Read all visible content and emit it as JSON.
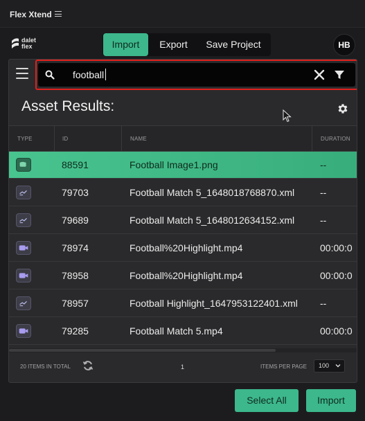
{
  "app": {
    "title": "Flex Xtend"
  },
  "logo": {
    "line1": "dalet",
    "line2": "flex"
  },
  "nav": {
    "tabs": [
      {
        "label": "Import",
        "active": true
      },
      {
        "label": "Export",
        "active": false
      },
      {
        "label": "Save Project",
        "active": false
      }
    ],
    "avatar": "HB"
  },
  "search": {
    "value": "football",
    "icons": [
      "search-icon",
      "clear-icon",
      "filter-icon"
    ]
  },
  "results": {
    "title": "Asset Results:"
  },
  "table": {
    "columns": [
      "TYPE",
      "ID",
      "NAME",
      "DURATION"
    ],
    "rows": [
      {
        "type": "image",
        "id": "88591",
        "name": "Football Image1.png",
        "duration": "--",
        "selected": true
      },
      {
        "type": "xml",
        "id": "79703",
        "name": "Football Match 5_1648018768870.xml",
        "duration": "--",
        "selected": false
      },
      {
        "type": "xml",
        "id": "79689",
        "name": "Football Match 5_1648012634152.xml",
        "duration": "--",
        "selected": false
      },
      {
        "type": "video",
        "id": "78974",
        "name": "Football%20Highlight.mp4",
        "duration": "00:00:0",
        "selected": false
      },
      {
        "type": "video",
        "id": "78958",
        "name": "Football%20Highlight.mp4",
        "duration": "00:00:0",
        "selected": false
      },
      {
        "type": "xml",
        "id": "78957",
        "name": "Football Highlight_1647953122401.xml",
        "duration": "--",
        "selected": false
      },
      {
        "type": "video",
        "id": "79285",
        "name": "Football Match 5.mp4",
        "duration": "00:00:0",
        "selected": false
      }
    ]
  },
  "footer": {
    "total": "20 ITEMS IN TOTAL",
    "page": "1",
    "items_per_page_label": "ITEMS PER PAGE",
    "items_per_page": "100"
  },
  "actions": {
    "select_all": "Select All",
    "import": "Import"
  },
  "colors": {
    "accent": "#3cb88c",
    "highlight_outline": "#e0201c",
    "background": "#1c1c1e"
  }
}
